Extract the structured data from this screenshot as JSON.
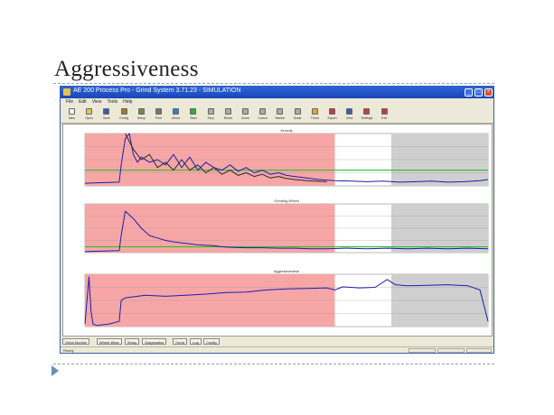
{
  "slide": {
    "title": "Aggressiveness"
  },
  "window": {
    "title": "AE 200 Process Pro - Grind System 3.71.23 - SIMULATION"
  },
  "menu": {
    "items": [
      "File",
      "Edit",
      "View",
      "Tools",
      "Help"
    ]
  },
  "toolbar": {
    "buttons": [
      {
        "label": "New",
        "icon": "new-file-icon",
        "color": "#f4f4f4"
      },
      {
        "label": "Open",
        "icon": "folder-open-icon",
        "color": "#e8c34a"
      },
      {
        "label": "Save",
        "icon": "save-icon",
        "color": "#3a5fb0"
      },
      {
        "label": "Config",
        "icon": "config-icon",
        "color": "#9a7b3a"
      },
      {
        "label": "Setup",
        "icon": "setup-icon",
        "color": "#7a8a4a"
      },
      {
        "label": "Print",
        "icon": "printer-icon",
        "color": "#777777"
      },
      {
        "label": "About",
        "icon": "help-icon",
        "color": "#2e7fd0"
      },
      {
        "label": "Start",
        "icon": "start-chart-icon",
        "color": "#3aa83a"
      },
      {
        "label": "Stop",
        "icon": "stop-chart-icon",
        "color": "#aaaaaa"
      },
      {
        "label": "Reset",
        "icon": "reset-chart-icon",
        "color": "#aaaaaa"
      },
      {
        "label": "Zoom",
        "icon": "zoom-chart-icon",
        "color": "#aaaaaa"
      },
      {
        "label": "Cursor",
        "icon": "cursor-chart-icon",
        "color": "#aaaaaa"
      },
      {
        "label": "Marker",
        "icon": "marker-chart-icon",
        "color": "#aaaaaa"
      },
      {
        "label": "Scale",
        "icon": "scale-chart-icon",
        "color": "#aaaaaa"
      },
      {
        "label": "Trend",
        "icon": "trend-chart-icon",
        "color": "#ddaa33"
      },
      {
        "label": "Export",
        "icon": "export-chart-icon",
        "color": "#c04040"
      },
      {
        "label": "View",
        "icon": "view-chart-icon",
        "color": "#3a5fb0"
      },
      {
        "label": "Settings",
        "icon": "settings-icon",
        "color": "#c04040"
      },
      {
        "label": "Exit",
        "icon": "exit-icon",
        "color": "#c04040"
      }
    ]
  },
  "tabs": {
    "items": [
      "Grind Monitor",
      "Wheel Wear",
      "Setup",
      "Diagnostics",
      "Trend",
      "Log",
      "Config"
    ]
  },
  "status": {
    "text": "Ready"
  },
  "colors": {
    "process_zone": "#f7a6a6",
    "idle_zone": "#cfcfcf",
    "signal": "#1b1fb0",
    "reference": "#2fbf2f",
    "secondary": "#2a2a2a"
  },
  "chart_data": [
    {
      "type": "line",
      "title": "Velocity",
      "zones": [
        {
          "kind": "process",
          "x_start": 0.0,
          "x_end": 0.62
        },
        {
          "kind": "idle",
          "x_start": 0.76,
          "x_end": 1.0
        }
      ],
      "threshold": {
        "y": 0.3,
        "color": "#2fbf2f"
      },
      "ylim": [
        0,
        1
      ],
      "series": [
        {
          "color": "#1b1fb0",
          "x": [
            0.0,
            0.04,
            0.085,
            0.09,
            0.1,
            0.11,
            0.12,
            0.13,
            0.14,
            0.16,
            0.18,
            0.2,
            0.22,
            0.24,
            0.26,
            0.28,
            0.3,
            0.32,
            0.34,
            0.36,
            0.38,
            0.4,
            0.42,
            0.44,
            0.46,
            0.48,
            0.5,
            0.52,
            0.55,
            0.58,
            0.62,
            0.66,
            0.7,
            0.74,
            0.78,
            0.82,
            0.86,
            0.9,
            0.94,
            0.98,
            1.0
          ],
          "y": [
            0.05,
            0.06,
            0.07,
            0.4,
            0.9,
            1.0,
            0.6,
            0.45,
            0.55,
            0.45,
            0.5,
            0.4,
            0.6,
            0.35,
            0.55,
            0.3,
            0.45,
            0.35,
            0.3,
            0.4,
            0.28,
            0.35,
            0.25,
            0.3,
            0.22,
            0.25,
            0.2,
            0.18,
            0.15,
            0.12,
            0.1,
            0.09,
            0.08,
            0.09,
            0.07,
            0.08,
            0.09,
            0.07,
            0.08,
            0.1,
            0.12
          ]
        },
        {
          "color": "#2a2a2a",
          "x": [
            0.1,
            0.12,
            0.14,
            0.16,
            0.18,
            0.2,
            0.22,
            0.24,
            0.26,
            0.28,
            0.3,
            0.32,
            0.34,
            0.36,
            0.38,
            0.4,
            0.42,
            0.44,
            0.46,
            0.48,
            0.5,
            0.52,
            0.55,
            0.6
          ],
          "y": [
            1.0,
            0.7,
            0.5,
            0.6,
            0.35,
            0.45,
            0.3,
            0.5,
            0.3,
            0.4,
            0.25,
            0.35,
            0.22,
            0.3,
            0.2,
            0.25,
            0.18,
            0.22,
            0.15,
            0.18,
            0.14,
            0.12,
            0.1,
            0.08
          ]
        }
      ]
    },
    {
      "type": "line",
      "title": "Grinding Wheel",
      "zones": [
        {
          "kind": "process",
          "x_start": 0.0,
          "x_end": 0.62
        },
        {
          "kind": "idle",
          "x_start": 0.76,
          "x_end": 1.0
        }
      ],
      "threshold": {
        "y": 0.12,
        "color": "#2fbf2f"
      },
      "ylim": [
        0,
        1
      ],
      "series": [
        {
          "color": "#1b1fb0",
          "x": [
            0.0,
            0.04,
            0.085,
            0.09,
            0.1,
            0.12,
            0.14,
            0.16,
            0.18,
            0.2,
            0.22,
            0.24,
            0.26,
            0.28,
            0.3,
            0.32,
            0.34,
            0.36,
            0.4,
            0.44,
            0.48,
            0.52,
            0.56,
            0.6,
            0.65,
            0.7,
            0.75,
            0.8,
            0.85,
            0.9,
            0.95,
            1.0
          ],
          "y": [
            0.02,
            0.03,
            0.04,
            0.35,
            0.85,
            0.7,
            0.5,
            0.35,
            0.3,
            0.25,
            0.22,
            0.2,
            0.18,
            0.16,
            0.15,
            0.14,
            0.12,
            0.11,
            0.1,
            0.1,
            0.09,
            0.09,
            0.08,
            0.08,
            0.09,
            0.08,
            0.09,
            0.08,
            0.09,
            0.08,
            0.09,
            0.08
          ]
        }
      ]
    },
    {
      "type": "line",
      "title": "Aggressiveness",
      "zones": [
        {
          "kind": "process",
          "x_start": 0.0,
          "x_end": 0.62
        },
        {
          "kind": "idle",
          "x_start": 0.76,
          "x_end": 1.0
        }
      ],
      "ylim": [
        0,
        1
      ],
      "series": [
        {
          "color": "#1b1fb0",
          "x": [
            0.0,
            0.01,
            0.015,
            0.02,
            0.03,
            0.06,
            0.085,
            0.09,
            0.1,
            0.15,
            0.2,
            0.25,
            0.3,
            0.35,
            0.4,
            0.45,
            0.5,
            0.55,
            0.6,
            0.62,
            0.64,
            0.68,
            0.72,
            0.75,
            0.77,
            0.8,
            0.85,
            0.9,
            0.95,
            0.98,
            1.0
          ],
          "y": [
            0.05,
            0.95,
            0.3,
            0.05,
            0.02,
            0.05,
            0.1,
            0.5,
            0.55,
            0.6,
            0.58,
            0.6,
            0.62,
            0.65,
            0.66,
            0.7,
            0.72,
            0.73,
            0.74,
            0.7,
            0.76,
            0.74,
            0.75,
            0.9,
            0.8,
            0.78,
            0.79,
            0.8,
            0.78,
            0.7,
            0.1
          ]
        }
      ]
    }
  ]
}
